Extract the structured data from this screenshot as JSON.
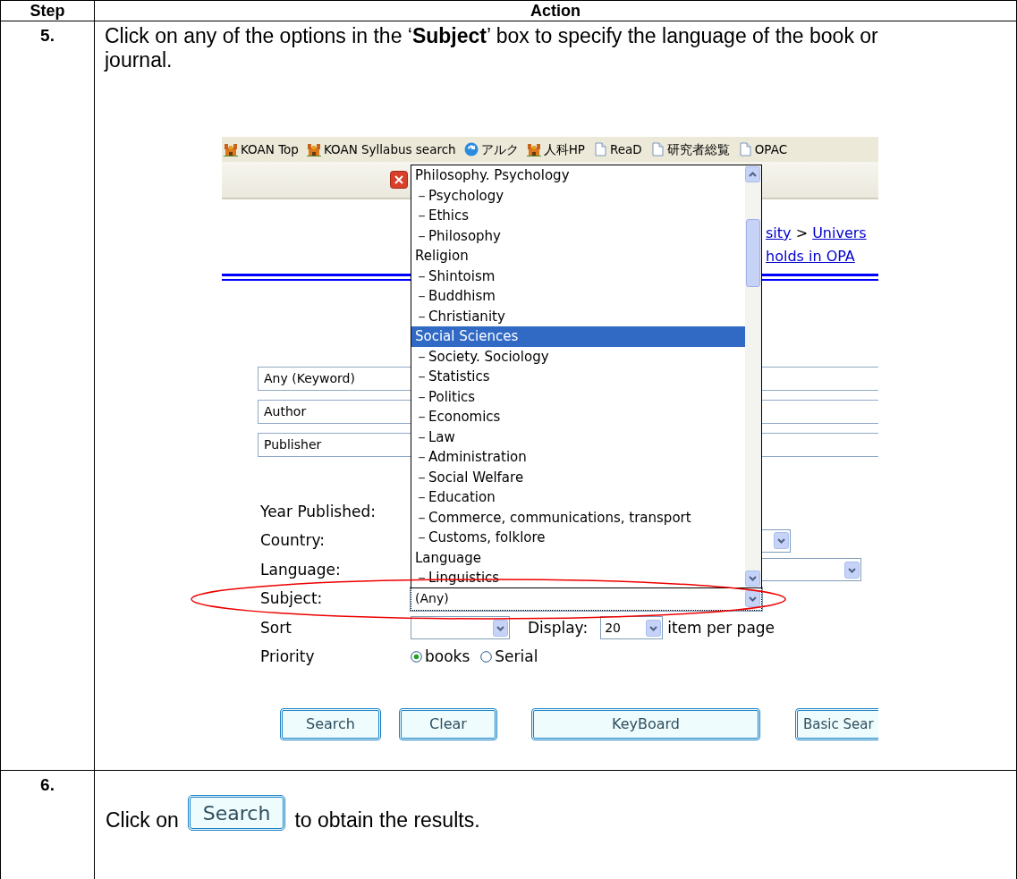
{
  "table": {
    "columns": [
      "Step",
      "Action"
    ],
    "rows": [
      {
        "kind": "screenshot",
        "step": "5.",
        "instruction": "Click on any of the options in the ‘**Subject**’ box to specify the language of the book or journal.",
        "screenshot": {
          "bookmarks": [
            {
              "label": "KOAN Top",
              "kind": "castle"
            },
            {
              "label": "KOAN Syllabus search",
              "kind": "castle"
            },
            {
              "label": "アルク",
              "kind": "circle"
            },
            {
              "label": "人科HP",
              "kind": "castle"
            },
            {
              "label": "ReaD",
              "kind": "page"
            },
            {
              "label": "研究者総覧",
              "kind": "page"
            },
            {
              "label": "OPAC",
              "kind": "page"
            }
          ],
          "breadcrumb": [
            {
              "text": "sity",
              "kind": "link"
            },
            {
              "text": ">",
              "kind": "separator"
            },
            {
              "text": "Univers",
              "kind": "link"
            }
          ],
          "breadcrumb_line2": "holds in OPA",
          "search_fields": [
            "Any (Keyword)",
            "Author",
            "Publisher"
          ],
          "form_rows": [
            {
              "label": "Year Published:",
              "kind": "hidden"
            },
            {
              "label": "Country:",
              "kind": "select_short"
            },
            {
              "label": "Language:",
              "kind": "select_long"
            },
            {
              "label": "Subject:",
              "kind": "subject",
              "value": "(Any)",
              "focused": true,
              "highlighted": true
            }
          ],
          "sort": {
            "label": "Sort"
          },
          "display": {
            "label": "Display:",
            "value": "20",
            "suffix": "item per page"
          },
          "priority": {
            "label": "Priority",
            "options": [
              {
                "label": "books",
                "selected": true
              },
              {
                "label": "Serial",
                "selected": false
              }
            ]
          },
          "buttons": [
            "Search",
            "Clear",
            "KeyBoard",
            "Basic Sear"
          ],
          "subject_options": [
            {
              "label": "Philosophy. Psychology",
              "selected": false
            },
            {
              "label": "－Psychology",
              "selected": false
            },
            {
              "label": "－Ethics",
              "selected": false
            },
            {
              "label": "－Philosophy",
              "selected": false
            },
            {
              "label": "Religion",
              "selected": false
            },
            {
              "label": "－Shintoism",
              "selected": false
            },
            {
              "label": "－Buddhism",
              "selected": false
            },
            {
              "label": "－Christianity",
              "selected": false
            },
            {
              "label": "Social Sciences",
              "selected": true
            },
            {
              "label": "－Society. Sociology",
              "selected": false
            },
            {
              "label": "－Statistics",
              "selected": false
            },
            {
              "label": "－Politics",
              "selected": false
            },
            {
              "label": "－Economics",
              "selected": false
            },
            {
              "label": "－Law",
              "selected": false
            },
            {
              "label": "－Administration",
              "selected": false
            },
            {
              "label": "－Social Welfare",
              "selected": false
            },
            {
              "label": "－Education",
              "selected": false
            },
            {
              "label": "－Commerce, communications, transport",
              "selected": false
            },
            {
              "label": "－Customs, folklore",
              "selected": false
            },
            {
              "label": "Language",
              "selected": false
            },
            {
              "label": "－Linguistics",
              "selected": false
            }
          ]
        }
      },
      {
        "kind": "inline_button",
        "step": "6.",
        "instruction_before": "Click on",
        "button": "Search",
        "instruction_after": "to obtain the results."
      }
    ]
  }
}
